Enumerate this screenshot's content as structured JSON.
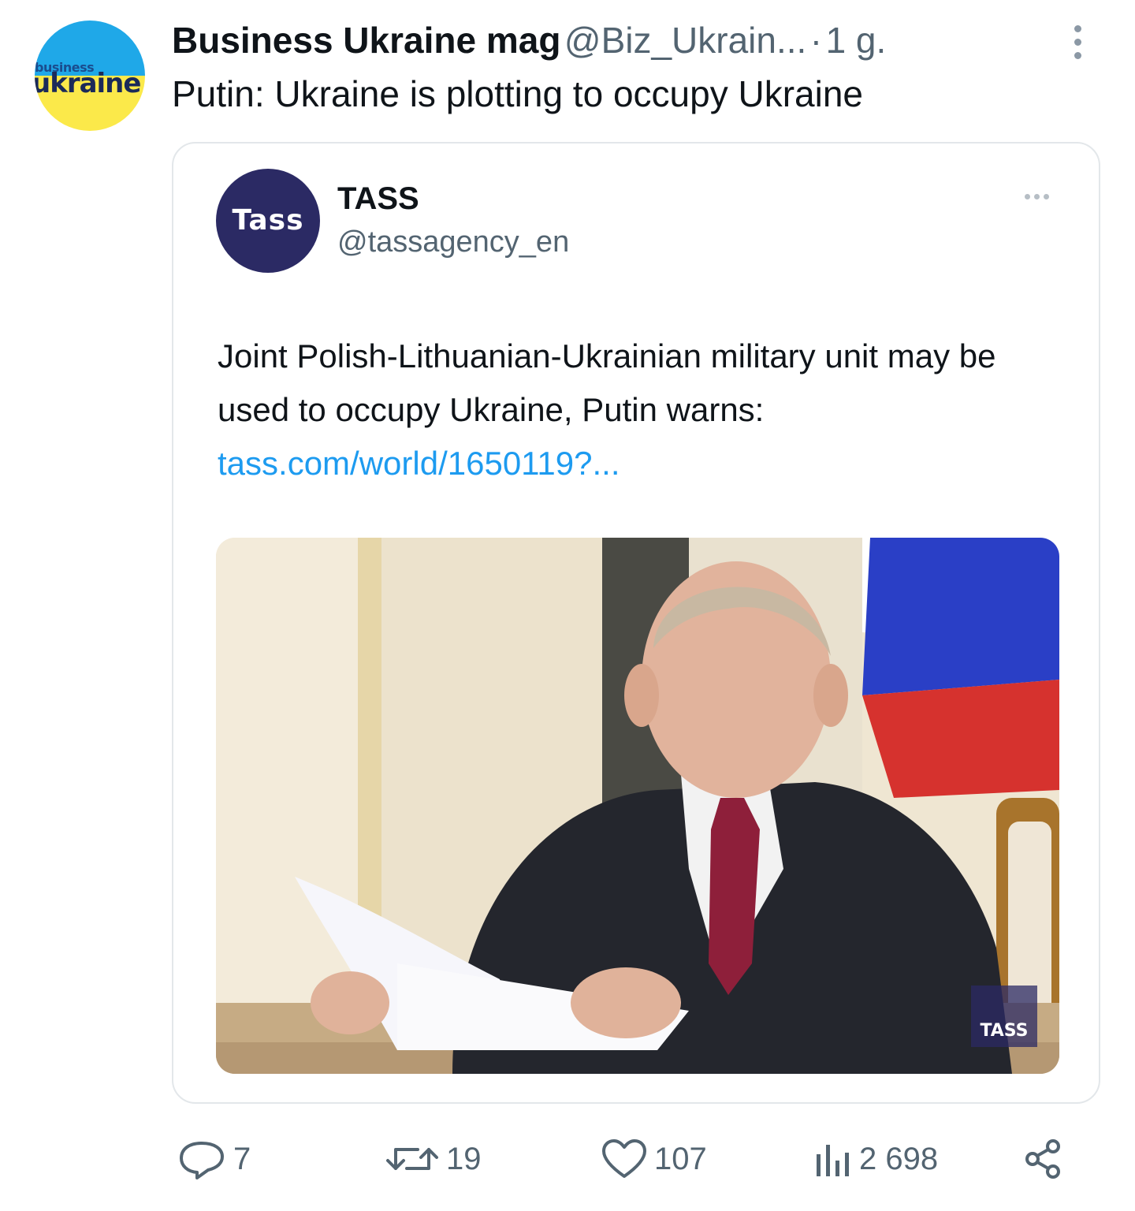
{
  "tweet": {
    "author_name": "Business Ukraine mag",
    "author_handle": "@Biz_Ukrain...",
    "separator": "·",
    "time": "1 g.",
    "text": "Putin: Ukraine is plotting to occupy Ukraine",
    "avatar": {
      "logo_small": "business",
      "logo_big": "ukraine"
    }
  },
  "quote": {
    "avatar_text": "Tass",
    "name": "TASS",
    "handle": "@tassagency_en",
    "text": "Joint Polish-Lithuanian-Ukrainian military unit may be used to occupy Ukraine, Putin warns:",
    "link": "tass.com/world/1650119?...",
    "photo_watermark": "TASS"
  },
  "actions": {
    "replies": "7",
    "retweets": "19",
    "likes": "107",
    "views": "2 698"
  },
  "colors": {
    "link": "#1d9bf0",
    "muted": "#536471",
    "tass_brand": "#2b2a64"
  }
}
